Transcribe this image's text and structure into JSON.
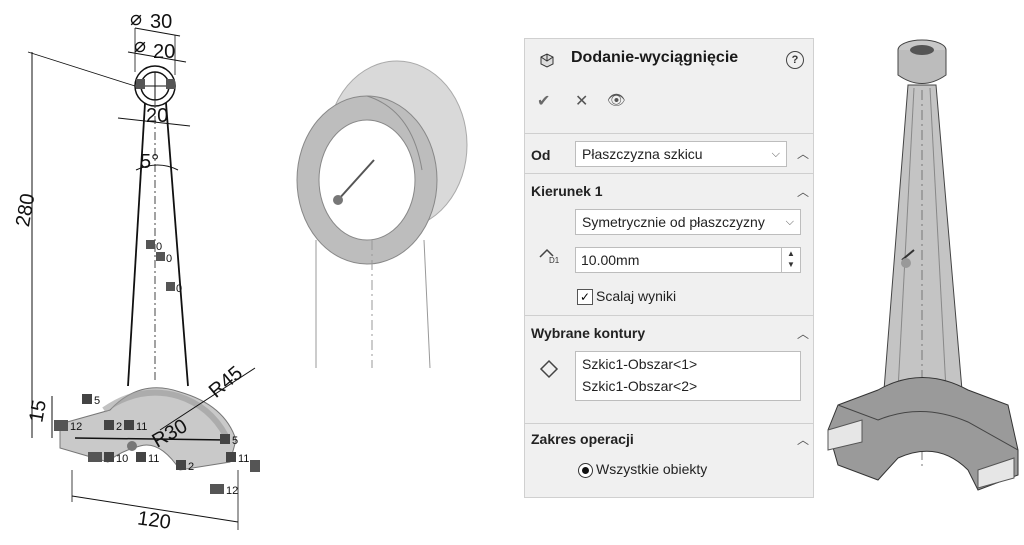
{
  "sketch": {
    "dims": {
      "d30": "30",
      "d20top": "20",
      "d20mid": "20",
      "angle": "5°",
      "h280": "280",
      "h15": "15",
      "r45": "R45",
      "r30": "R30",
      "w120": "120"
    },
    "relations": [
      "0",
      "0",
      "0",
      "5",
      "12",
      "2",
      "11",
      "5",
      "10",
      "11",
      "2",
      "11",
      "12"
    ]
  },
  "panel": {
    "title": "Dodanie-wyciągnięcie",
    "help_icon": "?",
    "ok_icon": "✔",
    "cancel_icon": "✕",
    "preview_icon": "👁",
    "from": {
      "label": "Od",
      "value": "Płaszczyzna szkicu"
    },
    "direction1": {
      "label": "Kierunek 1",
      "end_condition": "Symetrycznie od płaszczyzny",
      "depth": "10.00mm",
      "merge_label": "Scalaj wyniki",
      "merge_checked": true
    },
    "contours": {
      "label": "Wybrane kontury",
      "items": [
        "Szkic1-Obszar<1>",
        "Szkic1-Obszar<2>"
      ]
    },
    "scope": {
      "label": "Zakres operacji",
      "option": "Wszystkie obiekty"
    }
  }
}
